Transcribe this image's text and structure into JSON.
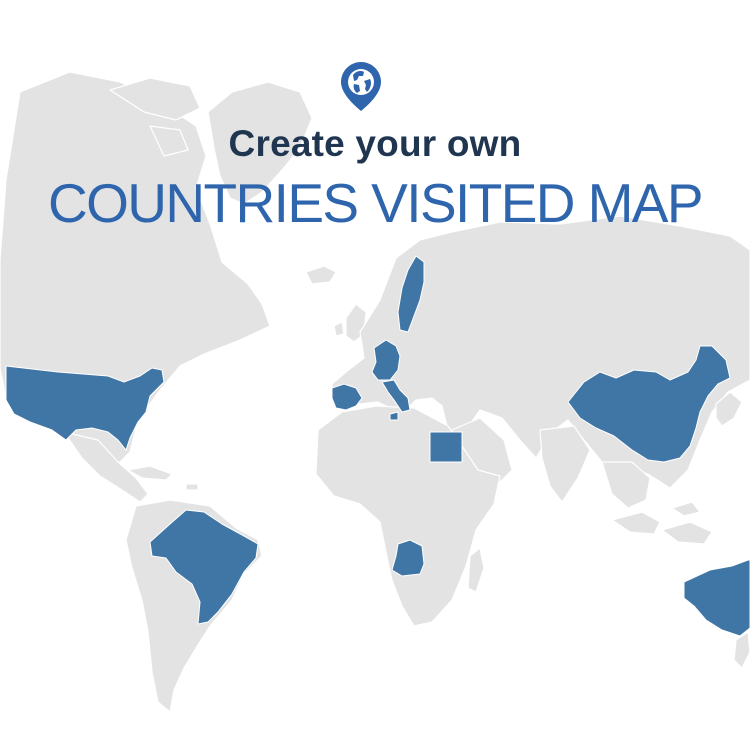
{
  "header": {
    "subtitle": "Create your own",
    "title": "COUNTRIES VISITED MAP",
    "icon": "globe-location-pin-icon"
  },
  "colors": {
    "visited": "#3f76a5",
    "land": "#e3e3e3",
    "border": "#ffffff",
    "subtitle": "#1f3550",
    "title": "#2e65ad",
    "background": "#ffffff"
  },
  "map": {
    "visited_countries": [
      "United States",
      "Brazil",
      "Spain",
      "France",
      "Italy",
      "Sweden",
      "Egypt",
      "Angola",
      "China",
      "Australia"
    ]
  }
}
